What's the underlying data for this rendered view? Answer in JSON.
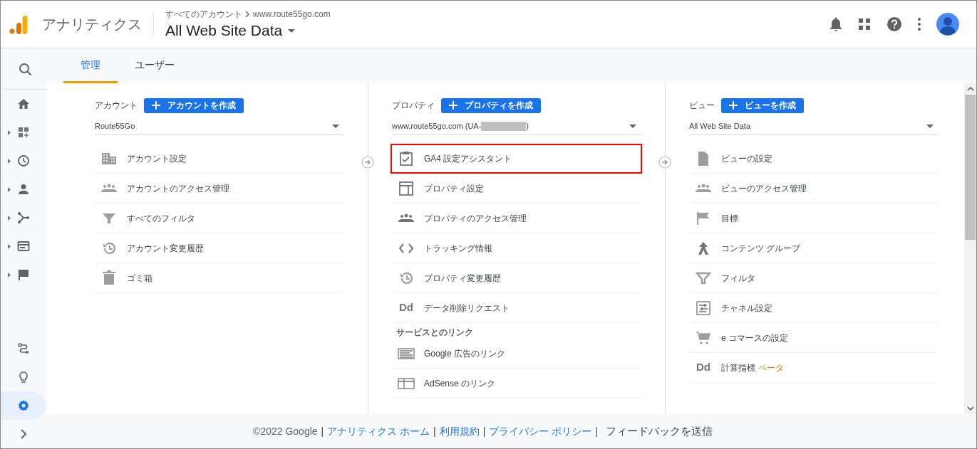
{
  "header": {
    "product": "アナリティクス",
    "breadcrumb": [
      "すべてのアカウント",
      "www.route55go.com"
    ],
    "view_title": "All Web Site Data"
  },
  "sidebar": {
    "items": [
      {
        "selected": false,
        "expandable": false
      },
      {
        "selected": false,
        "expandable": false
      },
      {
        "selected": false,
        "expandable": true
      },
      {
        "selected": false,
        "expandable": true
      },
      {
        "selected": false,
        "expandable": true
      },
      {
        "selected": false,
        "expandable": true
      },
      {
        "selected": false,
        "expandable": true
      },
      {
        "selected": false,
        "expandable": true
      },
      {
        "selected": false,
        "expandable": false
      },
      {
        "selected": false,
        "expandable": false
      },
      {
        "selected": true,
        "expandable": false
      },
      {
        "selected": false,
        "expandable": false
      }
    ]
  },
  "tabs": [
    {
      "label": "管理",
      "selected": true
    },
    {
      "label": "ユーザー",
      "selected": false
    }
  ],
  "columns": [
    {
      "label": "アカウント",
      "create_button": "アカウントを作成",
      "dropdown": {
        "value": "Route55Go"
      },
      "sections": [
        {
          "items": [
            {
              "label": "アカウント設定",
              "highlighted": false
            },
            {
              "label": "アカウントのアクセス管理",
              "highlighted": false
            },
            {
              "label": "すべてのフィルタ",
              "highlighted": false
            },
            {
              "label": "アカウント変更履歴",
              "highlighted": false
            },
            {
              "label": "ゴミ箱",
              "highlighted": false
            }
          ]
        }
      ]
    },
    {
      "label": "プロパティ",
      "create_button": "プロパティを作成",
      "dropdown": {
        "value": "www.route55go.com (UA-",
        "redacted": true,
        "value_end": ")"
      },
      "sections": [
        {
          "items": [
            {
              "label": "GA4 設定アシスタント",
              "highlighted": true
            },
            {
              "label": "プロパティ設定",
              "highlighted": false
            },
            {
              "label": "プロパティのアクセス管理",
              "highlighted": false
            },
            {
              "label": "トラッキング情報",
              "highlighted": false
            },
            {
              "label": "プロパティ変更履歴",
              "highlighted": false
            },
            {
              "label": "データ削除リクエスト",
              "highlighted": false,
              "icon_text": "Dd"
            }
          ]
        },
        {
          "title": "サービスとのリンク",
          "items": [
            {
              "label": "Google 広告のリンク",
              "highlighted": false
            },
            {
              "label": "AdSense のリンク",
              "highlighted": false
            }
          ]
        }
      ]
    },
    {
      "label": "ビュー",
      "create_button": "ビューを作成",
      "dropdown": {
        "value": "All Web Site Data"
      },
      "sections": [
        {
          "items": [
            {
              "label": "ビューの設定",
              "highlighted": false
            },
            {
              "label": "ビューのアクセス管理",
              "highlighted": false
            },
            {
              "label": "目標",
              "highlighted": false
            },
            {
              "label": "コンテンツ グループ",
              "highlighted": false
            },
            {
              "label": "フィルタ",
              "highlighted": false
            },
            {
              "label": "チャネル設定",
              "highlighted": false
            },
            {
              "label": "e コマースの設定",
              "highlighted": false
            },
            {
              "label": "計算指標",
              "highlighted": false,
              "badge": "ベータ",
              "icon_text": "Dd"
            }
          ]
        }
      ]
    }
  ],
  "footer": [
    {
      "kind": "text",
      "text": "©2022 Google"
    },
    {
      "kind": "separator",
      "text": "|"
    },
    {
      "kind": "link",
      "text": "アナリティクス ホーム"
    },
    {
      "kind": "separator",
      "text": "|"
    },
    {
      "kind": "link",
      "text": "利用規約"
    },
    {
      "kind": "separator",
      "text": "|"
    },
    {
      "kind": "link",
      "text": "プライバシー ポリシー"
    },
    {
      "kind": "separator",
      "text": "|"
    },
    {
      "kind": "text",
      "text": "フィードバックを送信"
    }
  ]
}
